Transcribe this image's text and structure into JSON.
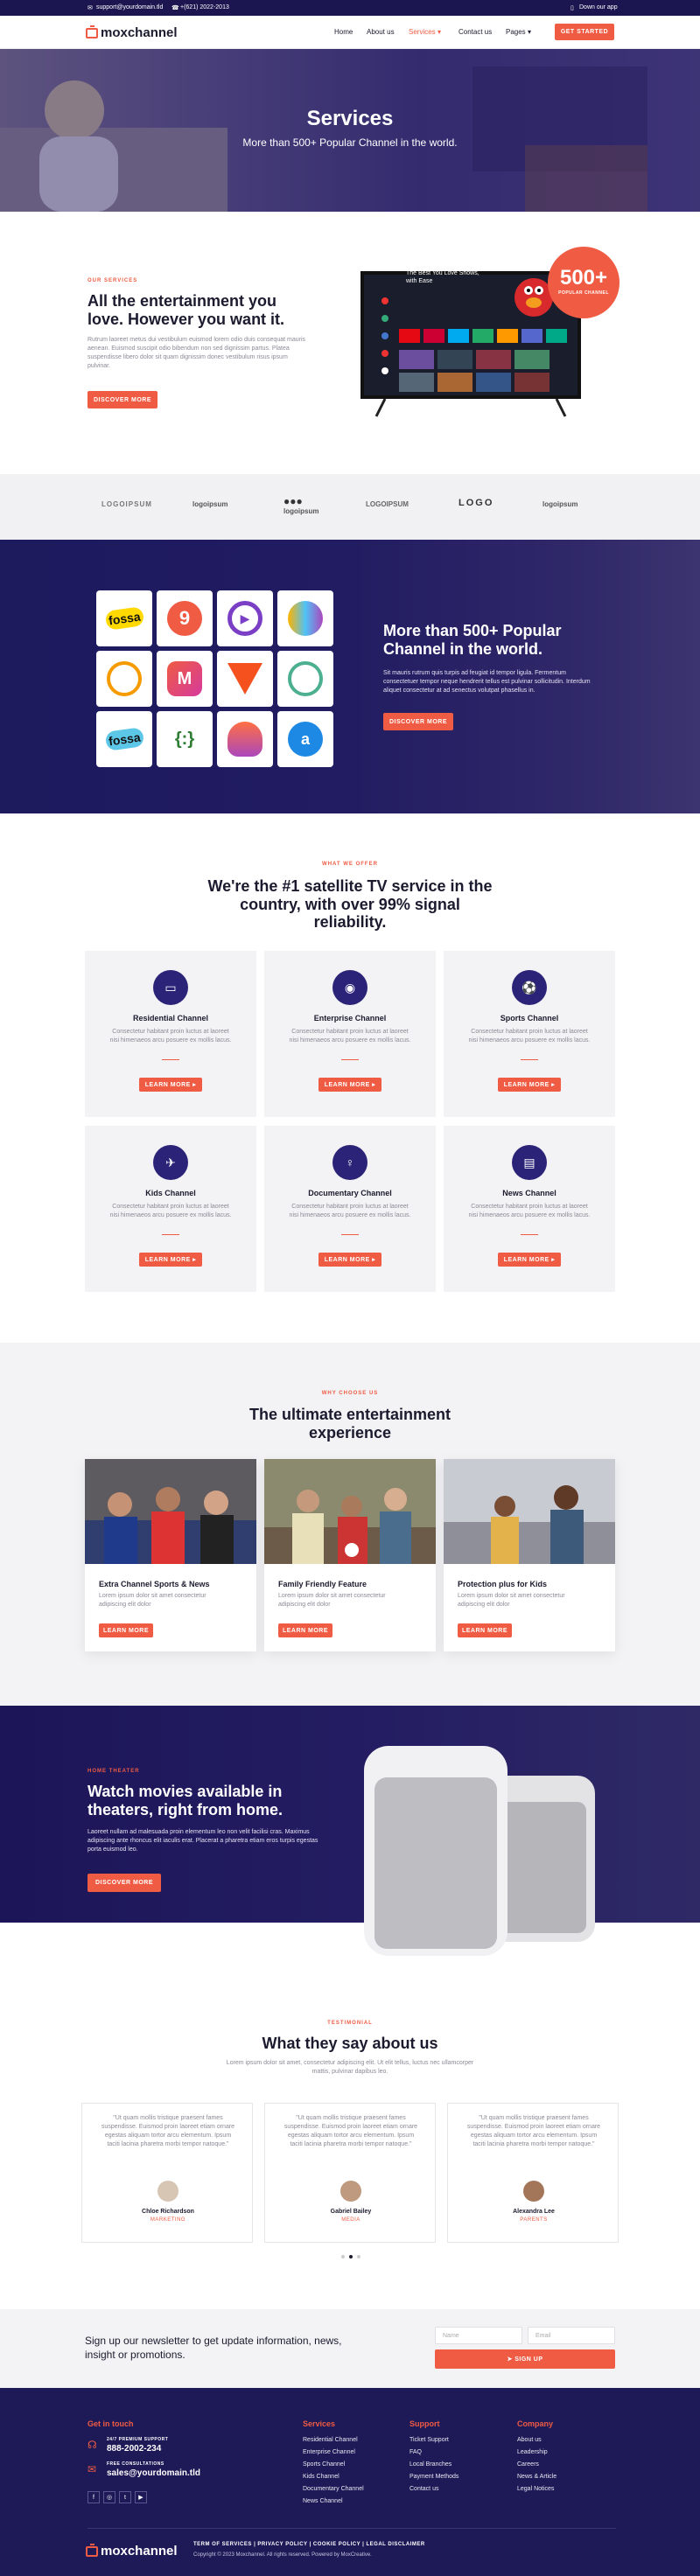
{
  "topbar": {
    "email": "support@yourdomain.tld",
    "phone": "+(621) 2022-2013",
    "app": "Down our app"
  },
  "nav": {
    "logo": "moxchannel",
    "items": [
      "Home",
      "About us",
      "Services",
      "Contact us",
      "Pages"
    ],
    "cta": "GET STARTED"
  },
  "hero": {
    "title": "Services",
    "subtitle": "More than 500+ Popular Channel in the world."
  },
  "about": {
    "label": "OUR SERVICES",
    "title": "All the entertainment you love. However you want it.",
    "text": "Rutrum laoreet metus dui vestibulum euismod lorem odio duis consequat mauris aenean. Euismod suscipit odio bibendum non sed dignissim partus. Platea suspendisse libero dolor sit quam dignissim donec vestibulum risus ipsum pulvinar.",
    "button": "DISCOVER MORE",
    "badge_num": "500+",
    "badge_text": "POPULAR CHANNEL",
    "tv_text": "The Best You Love Shows, with Ease"
  },
  "logos": [
    "LOGOIPSUM",
    "logoipsum",
    "logoipsum",
    "LOGOIPSUM",
    "LOGO",
    "logoipsum"
  ],
  "channels": {
    "title": "More than 500+ Popular Channel in the world.",
    "text": "Sit mauris rutrum quis turpis ad feugiat id tempor ligula. Fermentum consectetuer tempor neque hendrerit tellus est pulvinar sollicitudin. Interdum aliquet consectetur at ad senectus volutpat phasellus in.",
    "button": "DISCOVER MORE",
    "apps": [
      "fossa",
      "",
      "",
      "",
      "",
      "",
      "",
      "",
      "fossa",
      "{:}",
      "",
      ""
    ]
  },
  "offer": {
    "label": "WHAT WE OFFER",
    "title": "We're the #1 satellite TV service in the country, with over 99% signal reliability.",
    "cards": [
      {
        "title": "Residential Channel",
        "text": "Consectetur habitant proin luctus at laoreet nisi himenaeos arcu posuere ex mollis lacus.",
        "button": "LEARN MORE"
      },
      {
        "title": "Enterprise Channel",
        "text": "Consectetur habitant proin luctus at laoreet nisi himenaeos arcu posuere ex mollis lacus.",
        "button": "LEARN MORE"
      },
      {
        "title": "Sports Channel",
        "text": "Consectetur habitant proin luctus at laoreet nisi himenaeos arcu posuere ex mollis lacus.",
        "button": "LEARN MORE"
      },
      {
        "title": "Kids Channel",
        "text": "Consectetur habitant proin luctus at laoreet nisi himenaeos arcu posuere ex mollis lacus.",
        "button": "LEARN MORE"
      },
      {
        "title": "Documentary Channel",
        "text": "Consectetur habitant proin luctus at laoreet nisi himenaeos arcu posuere ex mollis lacus.",
        "button": "LEARN MORE"
      },
      {
        "title": "News Channel",
        "text": "Consectetur habitant proin luctus at laoreet nisi himenaeos arcu posuere ex mollis lacus.",
        "button": "LEARN MORE"
      }
    ]
  },
  "why": {
    "label": "WHY CHOOSE US",
    "title": "The ultimate entertainment experience",
    "cards": [
      {
        "title": "Extra Channel Sports & News",
        "text": "Lorem ipsum dolor sit amet consectetur adipiscing elit dolor",
        "button": "LEARN MORE"
      },
      {
        "title": "Family Friendly Feature",
        "text": "Lorem ipsum dolor sit amet consectetur adipiscing elit dolor",
        "button": "LEARN MORE"
      },
      {
        "title": "Protection plus for Kids",
        "text": "Lorem ipsum dolor sit amet consectetur adipiscing elit dolor",
        "button": "LEARN MORE"
      }
    ]
  },
  "movies": {
    "label": "HOME THEATER",
    "title": "Watch movies available in theaters, right from home.",
    "text": "Laoreet nullam ad malesuada proin elementum leo non velit facilisi cras. Maximus adipiscing ante rhoncus elit iaculis erat. Placerat a pharetra etiam eros turpis egestas porta euismod leo.",
    "button": "DISCOVER MORE"
  },
  "testimonial": {
    "label": "TESTIMONIAL",
    "title": "What they say about us",
    "subtitle": "Lorem ipsum dolor sit amet, consectetur adipiscing elit. Ut elit tellus, luctus nec ullamcorper mattis, pulvinar dapibus leo.",
    "items": [
      {
        "quote": "\"Ut quam mollis tristique praesent fames suspendisse. Euismod proin laoreet etiam ornare egestas aliquam tortor arcu elementum. Ipsum taciti lacinia pharetra morbi tempor natoque.\"",
        "name": "Chloe Richardson",
        "role": "MARKETING"
      },
      {
        "quote": "\"Ut quam mollis tristique praesent fames suspendisse. Euismod proin laoreet etiam ornare egestas aliquam tortor arcu elementum. Ipsum taciti lacinia pharetra morbi tempor natoque.\"",
        "name": "Gabriel Bailey",
        "role": "MEDIA"
      },
      {
        "quote": "\"Ut quam mollis tristique praesent fames suspendisse. Euismod proin laoreet etiam ornare egestas aliquam tortor arcu elementum. Ipsum taciti lacinia pharetra morbi tempor natoque.\"",
        "name": "Alexandra Lee",
        "role": "PARENTS"
      }
    ]
  },
  "newsletter": {
    "text": "Sign up our newsletter to get update information, news, insight or promotions.",
    "name_ph": "Name",
    "email_ph": "Email",
    "button": "SIGN UP"
  },
  "footer": {
    "contact_title": "Get in touch",
    "phone_label": "24/7 PREMIUM SUPPORT",
    "phone": "888-2002-234",
    "email_label": "FREE CONSULTATIONS",
    "email": "sales@yourdomain.tld",
    "services_title": "Services",
    "services": [
      "Residential Channel",
      "Enterprise Channel",
      "Sports Channel",
      "Kids Channel",
      "Documentary Channel",
      "News Channel"
    ],
    "support_title": "Support",
    "support": [
      "Ticket Support",
      "FAQ",
      "Local Branches",
      "Payment Methods",
      "Contact us"
    ],
    "company_title": "Company",
    "company": [
      "About us",
      "Leadership",
      "Careers",
      "News & Article",
      "Legal Notices"
    ],
    "legal": "TERM OF SERVICES  |  PRIVACY POLICY  |  COOKIE POLICY  |  LEGAL DISCLAIMER",
    "copyright": "Copyright © 2023 Moxchannel. All rights reserved. Powered by MoxCreative.",
    "logo": "moxchannel"
  },
  "colors": {
    "accent": "#ef5b43",
    "navy": "#1e1957"
  }
}
